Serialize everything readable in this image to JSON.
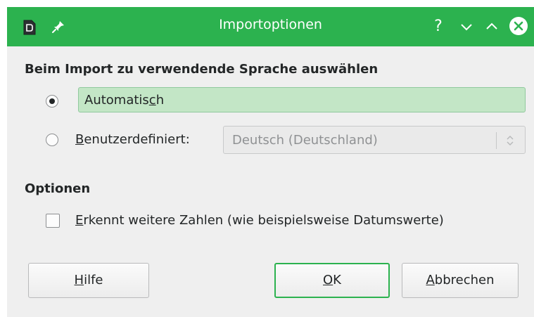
{
  "window": {
    "title": "Importoptionen",
    "help_label": "?",
    "accent_color": "#2cb24f"
  },
  "language_section": {
    "heading": "Beim Import zu verwendende Sprache auswählen",
    "automatic": {
      "label_pre": "Automatis",
      "label_mnemonic": "c",
      "label_post": "h",
      "selected": true
    },
    "custom": {
      "label_mnemonic": "B",
      "label_post": "enutzerdefiniert:",
      "selected": false,
      "combo_value": "Deutsch (Deutschland)"
    }
  },
  "options_section": {
    "heading": "Optionen",
    "detect_numbers": {
      "label_mnemonic": "E",
      "label_post": "rkennt weitere Zahlen (wie beispielsweise Datumswerte)",
      "checked": false
    }
  },
  "buttons": {
    "help": {
      "mnemonic": "H",
      "rest": "ilfe"
    },
    "ok": {
      "mnemonic": "O",
      "rest": "K"
    },
    "cancel": {
      "mnemonic": "A",
      "rest": "bbrechen"
    }
  },
  "icons": {
    "app": "document-icon",
    "pin": "pin-icon",
    "minimize": "chevron-down-icon",
    "maximize": "chevron-up-icon",
    "close": "close-icon"
  }
}
